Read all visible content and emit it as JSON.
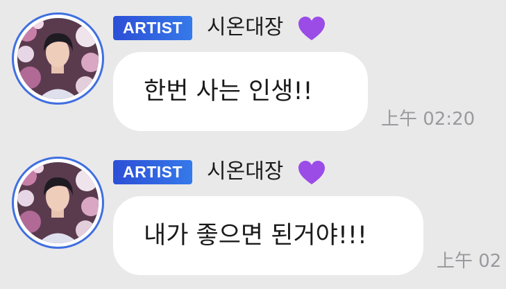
{
  "colors": {
    "background": "#e9e9ea",
    "badge": "#2c4fd6",
    "avatar_ring": "#3f6fe0",
    "heart": "#9b4ce6",
    "bubble": "#ffffff",
    "timestamp": "#9a9a9e"
  },
  "messages": [
    {
      "badge": "ARTIST",
      "sender": "시온대장",
      "heart_icon": "purple-heart-icon",
      "text": "한번 사는 인생!!",
      "time": "上午 02:20"
    },
    {
      "badge": "ARTIST",
      "sender": "시온대장",
      "heart_icon": "purple-heart-icon",
      "text": "내가 좋으면 된거야!!!",
      "time": "上午 02"
    }
  ]
}
